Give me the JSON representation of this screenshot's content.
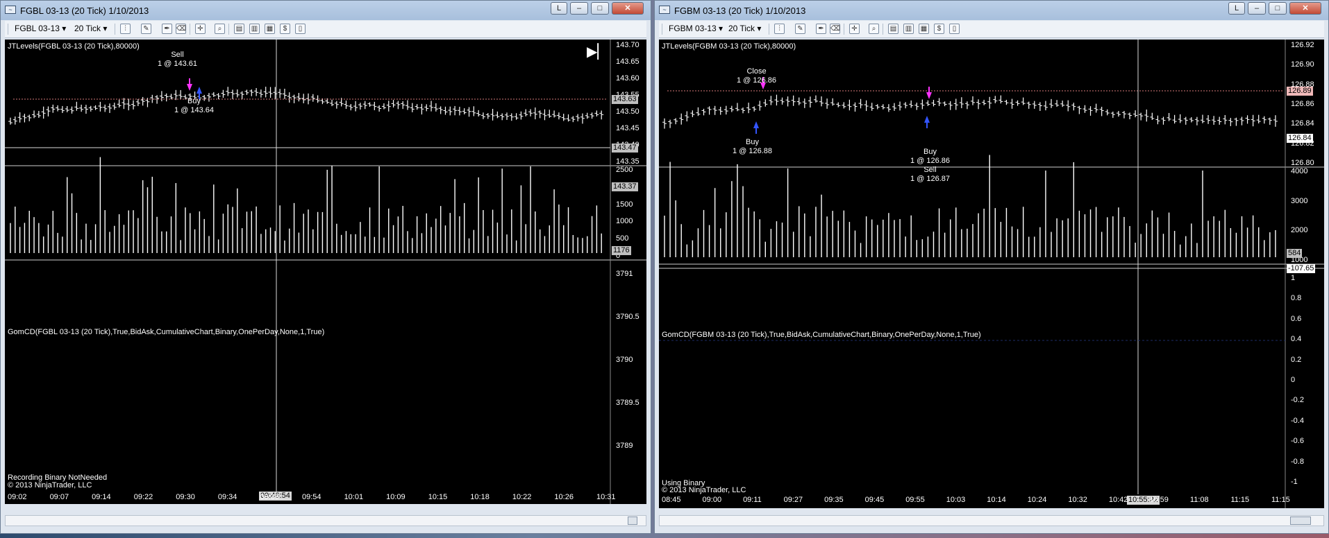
{
  "windows": [
    {
      "id": "fgbl",
      "title": "FGBL 03-13 (20 Tick)  1/10/2013",
      "toolbar": {
        "instrument": "FGBL 03-13",
        "interval": "20 Tick"
      },
      "indicator_label": "JTLevels(FGBL 03-13 (20 Tick),80000)",
      "gom_label": "GomCD(FGBL 03-13 (20 Tick),True,BidAsk,CumulativeChart,Binary,OnePerDay,None,1,True)",
      "status_line1": "Recording Binary NotNeeded",
      "status_line2": "© 2013 NinjaTrader, LLC",
      "annotations": [
        {
          "l1": "Sell",
          "l2": "1 @ 143.61"
        },
        {
          "l1": "Buy",
          "l2": "1 @ 143.64"
        }
      ],
      "price_axis": [
        "143.70",
        "143.65",
        "143.60",
        "143.55",
        "143.50",
        "143.45",
        "143.40",
        "143.35"
      ],
      "price_tags": [
        "143.63",
        "143.47",
        "143.37"
      ],
      "volume_axis": [
        "2500",
        "2000",
        "1500",
        "1000",
        "500",
        "0"
      ],
      "volume_tag": "1176",
      "gom_axis": [
        "3791",
        "3790.5",
        "3790",
        "3789.5",
        "3789"
      ],
      "time_labels": [
        "09:02",
        "09:07",
        "09:14",
        "09:22",
        "09:30",
        "09:34",
        "09:39",
        "09:54",
        "10:01",
        "10:09",
        "10:15",
        "10:18",
        "10:22",
        "10:26",
        "10:31"
      ],
      "cursor_time": "09:46:54"
    },
    {
      "id": "fgbm",
      "title": "FGBM 03-13 (20 Tick)  1/10/2013",
      "toolbar": {
        "instrument": "FGBM 03-13",
        "interval": "20 Tick"
      },
      "indicator_label": "JTLevels(FGBM 03-13 (20 Tick),80000)",
      "gom_label": "GomCD(FGBM 03-13 (20 Tick),True,BidAsk,CumulativeChart,Binary,OnePerDay,None,1,True)",
      "status_line1": "Using Binary",
      "status_line2": "© 2013 NinjaTrader, LLC",
      "annotations": [
        {
          "l1": "Close",
          "l2": "1 @ 126.86"
        },
        {
          "l1": "Buy",
          "l2": "1 @ 126.88"
        },
        {
          "l1": "Buy",
          "l2": "1 @ 126.86"
        },
        {
          "l1": "Sell",
          "l2": "1 @ 126.87"
        }
      ],
      "price_axis": [
        "126.92",
        "126.90",
        "126.88",
        "126.86",
        "126.84",
        "126.82",
        "126.80"
      ],
      "price_tags": [
        "126.89",
        "126.84"
      ],
      "volume_axis": [
        "4000",
        "3000",
        "2000",
        "1000"
      ],
      "volume_tag": "584",
      "gom_tag": "-107.65",
      "gom_axis": [
        "1",
        "0.8",
        "0.6",
        "0.4",
        "0.2",
        "0",
        "-0.2",
        "-0.4",
        "-0.6",
        "-0.8",
        "-1"
      ],
      "time_labels": [
        "08:45",
        "09:00",
        "09:11",
        "09:27",
        "09:35",
        "09:45",
        "09:55",
        "10:03",
        "10:14",
        "10:24",
        "10:32",
        "10:42",
        "10:59",
        "11:08",
        "11:15",
        "11:15"
      ],
      "cursor_time": "10:55:22"
    }
  ]
}
